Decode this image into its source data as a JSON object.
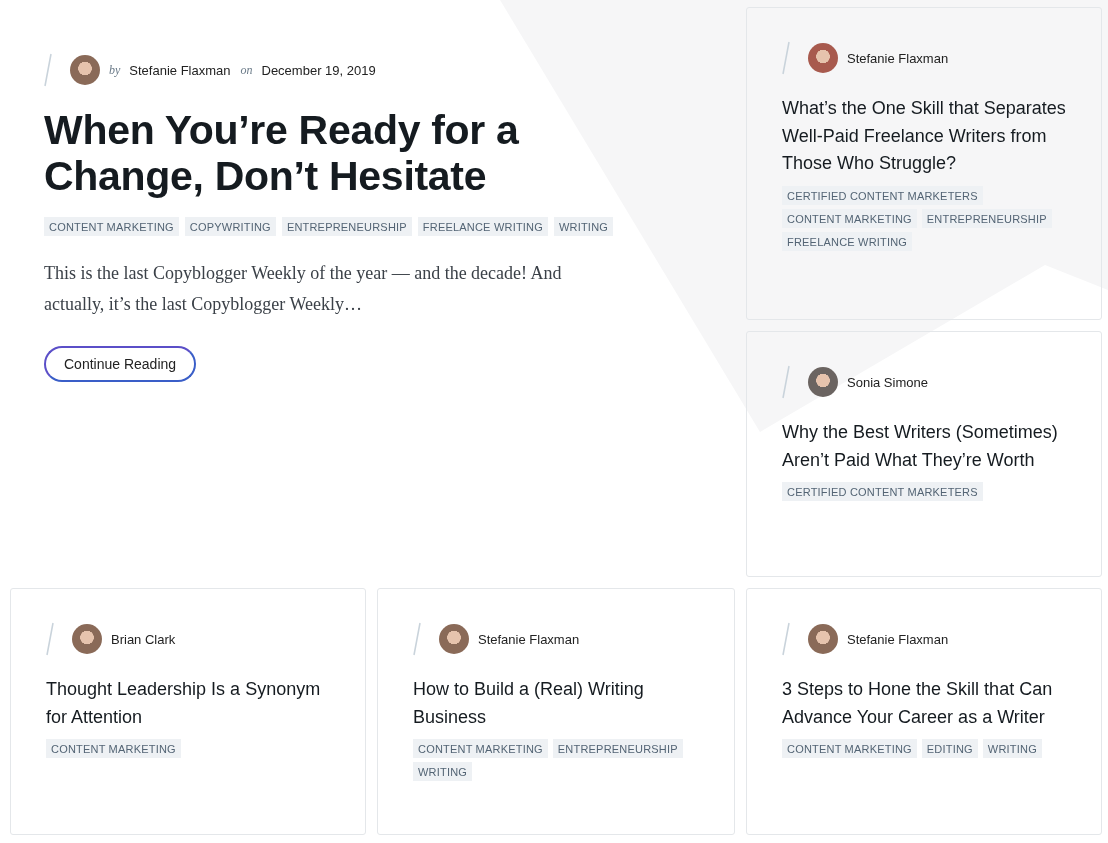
{
  "featured": {
    "author": "Stefanie Flaxman",
    "by_label": "by",
    "on_label": "on",
    "date": "December 19, 2019",
    "title": "When You’re Ready for a Change, Don’t Hesitate",
    "tags": [
      "CONTENT MARKETING",
      "COPYWRITING",
      "ENTREPRENEURSHIP",
      "FREELANCE WRITING",
      "WRITING"
    ],
    "excerpt": "This is the last Copyblogger Weekly of the year — and the decade! And actually, it’s the last Copyblogger Weekly…",
    "button": "Continue Reading"
  },
  "posts": [
    {
      "author": "Stefanie Flaxman",
      "title": "What’s the One Skill that Separates Well-Paid Freelance Writers from Those Who Struggle?",
      "tags": [
        "CERTIFIED CONTENT MARKETERS",
        "CONTENT MARKETING",
        "ENTREPRENEURSHIP",
        "FREELANCE WRITING"
      ]
    },
    {
      "author": "Sonia Simone",
      "title": "Why the Best Writers (Sometimes) Aren’t Paid What They’re Worth",
      "tags": [
        "CERTIFIED CONTENT MARKETERS"
      ]
    },
    {
      "author": "Brian Clark",
      "title": "Thought Leadership Is a Synonym for Attention",
      "tags": [
        "CONTENT MARKETING"
      ]
    },
    {
      "author": "Stefanie Flaxman",
      "title": "How to Build a (Real) Writing Business",
      "tags": [
        "CONTENT MARKETING",
        "ENTREPRENEURSHIP",
        "WRITING"
      ]
    },
    {
      "author": "Stefanie Flaxman",
      "title": "3 Steps to Hone the Skill that Can Advance Your Career as a Writer",
      "tags": [
        "CONTENT MARKETING",
        "EDITING",
        "WRITING"
      ]
    }
  ]
}
